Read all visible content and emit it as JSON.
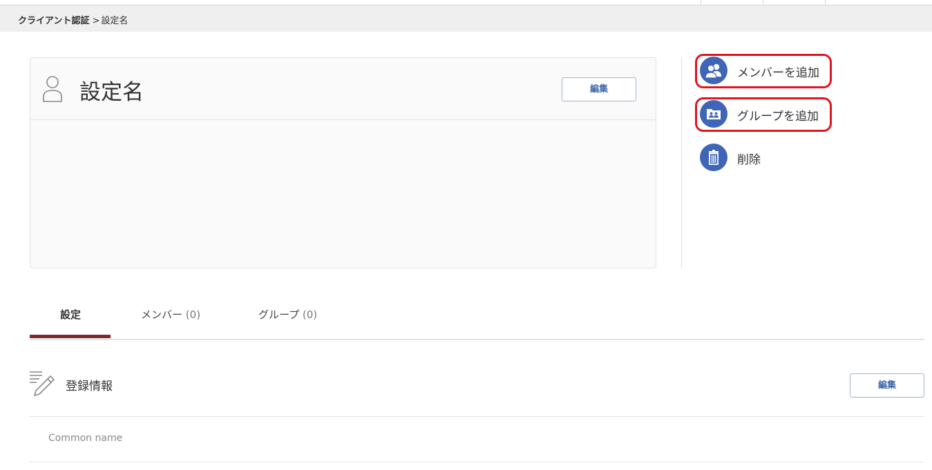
{
  "breadcrumb": {
    "root": "クライアント認証",
    "separator": ">",
    "current": "設定名"
  },
  "card": {
    "title": "設定名",
    "edit_label": "編集",
    "icon": "user-outline-icon"
  },
  "actions": [
    {
      "label": "メンバーを追加",
      "icon": "members-icon"
    },
    {
      "label": "グループを追加",
      "icon": "group-folder-icon"
    },
    {
      "label": "削除",
      "icon": "trash-icon"
    }
  ],
  "highlight_color": "#e0141e",
  "accent_color": "#3f66b6",
  "tabs": [
    {
      "label": "設定",
      "count": ""
    },
    {
      "label": "メンバー",
      "count": "(0)"
    },
    {
      "label": "グループ",
      "count": "(0)"
    }
  ],
  "active_tab_color": "#7b2a2e",
  "registration": {
    "title": "登録情報",
    "edit_label": "編集",
    "icon": "edit-list-icon"
  },
  "fields": [
    {
      "label": "Common name"
    }
  ]
}
